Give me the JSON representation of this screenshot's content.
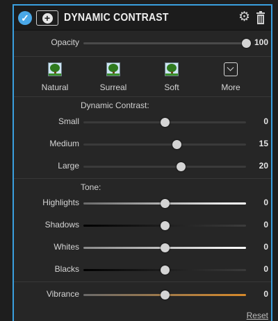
{
  "header": {
    "title": "DYNAMIC CONTRAST",
    "enabled_icon": "checkmark-circle-icon",
    "add_icon": "add-circle-icon",
    "settings_icon": "gear-icon",
    "delete_icon": "trash-icon"
  },
  "opacity": {
    "label": "Opacity",
    "value": "100",
    "level": 1.0
  },
  "presets": [
    {
      "label": "Natural",
      "icon": "tree-thumbnail-icon"
    },
    {
      "label": "Surreal",
      "icon": "tree-thumbnail-icon"
    },
    {
      "label": "Soft",
      "icon": "tree-thumbnail-icon"
    },
    {
      "label": "More",
      "icon": "chevron-down-box-icon"
    }
  ],
  "dynamic_contrast": {
    "title": "Dynamic Contrast:",
    "sliders": [
      {
        "label": "Small",
        "value": "0",
        "level": 0.5
      },
      {
        "label": "Medium",
        "value": "15",
        "level": 0.575
      },
      {
        "label": "Large",
        "value": "20",
        "level": 0.6
      }
    ]
  },
  "tone": {
    "title": "Tone:",
    "sliders": [
      {
        "label": "Highlights",
        "value": "0",
        "level": 0.5
      },
      {
        "label": "Shadows",
        "value": "0",
        "level": 0.5
      },
      {
        "label": "Whites",
        "value": "0",
        "level": 0.5
      },
      {
        "label": "Blacks",
        "value": "0",
        "level": 0.5
      }
    ]
  },
  "vibrance": {
    "label": "Vibrance",
    "value": "0",
    "level": 0.5
  },
  "reset_label": "Reset",
  "colors": {
    "accent": "#3aa0e0",
    "vibrance_track": "#d88a2a"
  }
}
